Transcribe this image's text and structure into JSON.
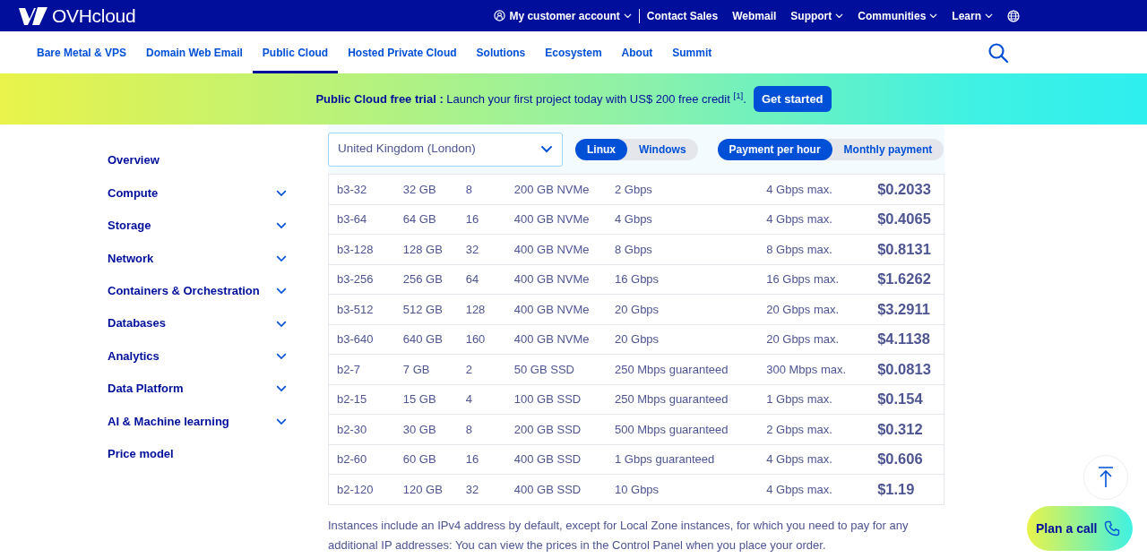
{
  "topbar": {
    "logo": "OVHcloud",
    "links": [
      {
        "label": "My customer account",
        "kind": "account",
        "dropdown": true
      },
      {
        "label": "Contact Sales",
        "kind": "link",
        "dropdown": false
      },
      {
        "label": "Webmail",
        "kind": "link",
        "dropdown": false
      },
      {
        "label": "Support",
        "kind": "link",
        "dropdown": true
      },
      {
        "label": "Communities",
        "kind": "link",
        "dropdown": true
      },
      {
        "label": "Learn",
        "kind": "link",
        "dropdown": true
      }
    ]
  },
  "nav": [
    {
      "label": "Bare Metal & VPS",
      "selected": false
    },
    {
      "label": "Domain Web Email",
      "selected": false
    },
    {
      "label": "Public Cloud",
      "selected": true
    },
    {
      "label": "Hosted Private Cloud",
      "selected": false
    },
    {
      "label": "Solutions",
      "selected": false
    },
    {
      "label": "Ecosystem",
      "selected": false
    },
    {
      "label": "About",
      "selected": false
    },
    {
      "label": "Summit",
      "selected": false
    }
  ],
  "banner": {
    "text": "**Public Cloud free trial :** Launch your first project today with US$ 200 free credit $^{[1]}$.",
    "button": "Get started"
  },
  "sidebar": {
    "items": [
      {
        "label": "Overview",
        "expandable": false
      },
      {
        "label": "Compute",
        "expandable": true
      },
      {
        "label": "Storage",
        "expandable": true
      },
      {
        "label": "Network",
        "expandable": true
      },
      {
        "label": "Containers & Orchestration",
        "expandable": true
      },
      {
        "label": "Databases",
        "expandable": true
      },
      {
        "label": "Analytics",
        "expandable": true
      },
      {
        "label": "Data Platform",
        "expandable": true
      },
      {
        "label": "AI & Machine learning",
        "expandable": true
      },
      {
        "label": "Price model",
        "expandable": false
      }
    ]
  },
  "filters": {
    "region": "United Kingdom (London)",
    "os": [
      {
        "label": "Linux",
        "selected": true
      },
      {
        "label": "Windows",
        "selected": false
      }
    ],
    "billing": [
      {
        "label": "Payment per hour",
        "selected": true
      },
      {
        "label": "Monthly payment",
        "selected": false
      }
    ]
  },
  "table": {
    "rows": [
      [
        "b3-32",
        "32 GB",
        "8",
        "200 GB NVMe",
        "2 Gbps",
        "4 Gbps max.",
        "$0.2033"
      ],
      [
        "b3-64",
        "64 GB",
        "16",
        "400 GB NVMe",
        "4 Gbps",
        "4 Gbps max.",
        "$0.4065"
      ],
      [
        "b3-128",
        "128 GB",
        "32",
        "400 GB NVMe",
        "8 Gbps",
        "8 Gbps max.",
        "$0.8131"
      ],
      [
        "b3-256",
        "256 GB",
        "64",
        "400 GB NVMe",
        "16 Gbps",
        "16 Gbps max.",
        "$1.6262"
      ],
      [
        "b3-512",
        "512 GB",
        "128",
        "400 GB NVMe",
        "20 Gbps",
        "20 Gbps max.",
        "$3.2911"
      ],
      [
        "b3-640",
        "640 GB",
        "160",
        "400 GB NVMe",
        "20 Gbps",
        "20 Gbps max.",
        "$4.1138"
      ],
      [
        "b2-7",
        "7 GB",
        "2",
        "50 GB SSD",
        "250 Mbps guaranteed",
        "300 Mbps max.",
        "$0.0813"
      ],
      [
        "b2-15",
        "15 GB",
        "4",
        "100 GB SSD",
        "250 Mbps guaranteed",
        "1 Gbps max.",
        "$0.154"
      ],
      [
        "b2-30",
        "30 GB",
        "8",
        "200 GB SSD",
        "500 Mbps guaranteed",
        "2 Gbps max.",
        "$0.312"
      ],
      [
        "b2-60",
        "60 GB",
        "16",
        "400 GB SSD",
        "1 Gbps guaranteed",
        "4 Gbps max.",
        "$0.606"
      ],
      [
        "b2-120",
        "120 GB",
        "32",
        "400 GB SSD",
        "10 Gbps",
        "4 Gbps max.",
        "$1.19"
      ]
    ]
  },
  "note": "Instances include an IPv4 address by default, except for Local Zone instances, for which you need to pay for any additional IP addresses: You can view the prices in the Control Panel when you place your order.",
  "floating": {
    "call_button": "Plan a call"
  }
}
